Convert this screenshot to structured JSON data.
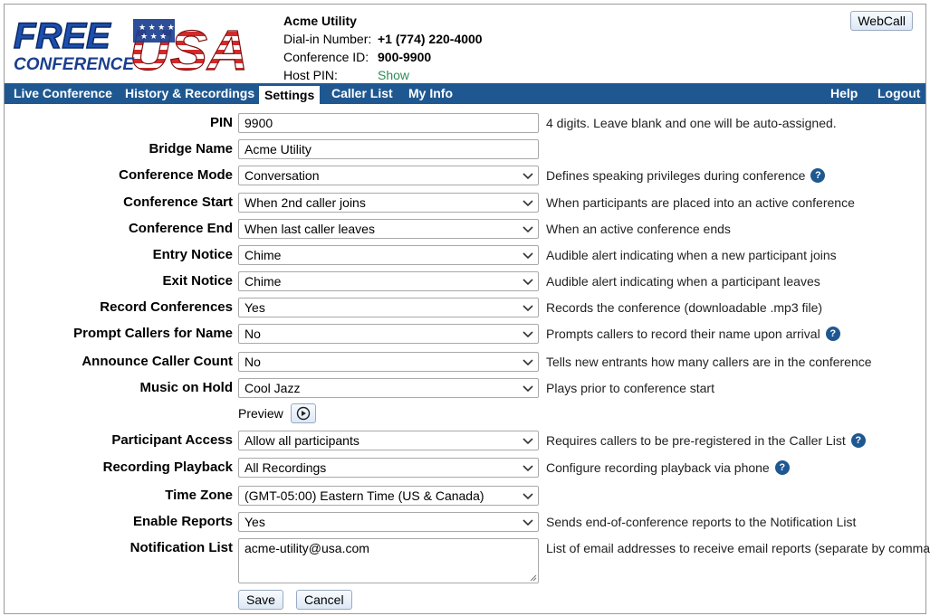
{
  "header": {
    "logo_text_top": "FREE",
    "logo_text_bottom": "CONFERENCE",
    "logo_text_usa": "USA",
    "account_name": "Acme Utility",
    "dialin_label": "Dial-in Number:",
    "dialin_value": "+1 (774) 220-4000",
    "confid_label": "Conference ID:",
    "confid_value": "900-9900",
    "hostpin_label": "Host PIN:",
    "hostpin_value": "Show",
    "webcall_label": "WebCall"
  },
  "nav": {
    "tabs": [
      "Live Conference",
      "History & Recordings",
      "Settings",
      "Caller List",
      "My Info"
    ],
    "active": "Settings",
    "right": [
      "Help",
      "Logout"
    ],
    "color": "#1f5891"
  },
  "form": {
    "pin": {
      "label": "PIN",
      "value": "9900",
      "help": "4 digits. Leave blank and one will be auto-assigned."
    },
    "bridge_name": {
      "label": "Bridge Name",
      "value": "Acme Utility"
    },
    "conference_mode": {
      "label": "Conference Mode",
      "value": "Conversation",
      "help": "Defines speaking privileges during conference"
    },
    "conference_start": {
      "label": "Conference Start",
      "value": "When 2nd caller joins",
      "help": "When participants are placed into an active conference"
    },
    "conference_end": {
      "label": "Conference End",
      "value": "When last caller leaves",
      "help": "When an active conference ends"
    },
    "entry_notice": {
      "label": "Entry Notice",
      "value": "Chime",
      "help": "Audible alert indicating when a new participant joins"
    },
    "exit_notice": {
      "label": "Exit Notice",
      "value": "Chime",
      "help": "Audible alert indicating when a participant leaves"
    },
    "record_conferences": {
      "label": "Record Conferences",
      "value": "Yes",
      "help": "Records the conference (downloadable .mp3 file)"
    },
    "prompt_callers": {
      "label": "Prompt Callers for Name",
      "value": "No",
      "help": "Prompts callers to record their name upon arrival"
    },
    "announce_count": {
      "label": "Announce Caller Count",
      "value": "No",
      "help": "Tells new entrants how many callers are in the conference"
    },
    "music_on_hold": {
      "label": "Music on Hold",
      "value": "Cool Jazz",
      "help": "Plays prior to conference start"
    },
    "preview_label": "Preview",
    "participant_access": {
      "label": "Participant Access",
      "value": "Allow all participants",
      "help": "Requires callers to be pre-registered in the Caller List"
    },
    "recording_playback": {
      "label": "Recording Playback",
      "value": "All Recordings",
      "help": "Configure recording playback via phone"
    },
    "time_zone": {
      "label": "Time Zone",
      "value": "(GMT-05:00) Eastern Time (US & Canada)"
    },
    "enable_reports": {
      "label": "Enable Reports",
      "value": "Yes",
      "help": "Sends end-of-conference reports to the Notification List"
    },
    "notification_list": {
      "label": "Notification List",
      "value": "acme-utility@usa.com",
      "help": "List of email addresses to receive email reports (separate by comma)"
    },
    "save_label": "Save",
    "cancel_label": "Cancel",
    "help_icon": "question-icon"
  }
}
